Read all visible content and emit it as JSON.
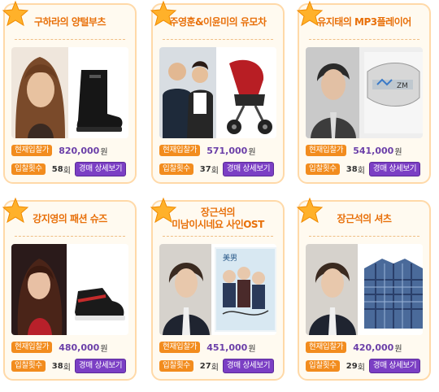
{
  "colors": {
    "accent": "#f28c1e",
    "title": "#e8700a",
    "price": "#6b3fa8",
    "button": "#7b3fc4"
  },
  "labels": {
    "current_bid": "현재입찰가",
    "bid_count": "입찰횟수",
    "detail_button": "경매 상세보기",
    "won_unit": "원",
    "count_unit": "회"
  },
  "items": [
    {
      "title": "구하라의 양털부츠",
      "price": "820,000",
      "bids": "58"
    },
    {
      "title": "주영훈&이윤미의 유모차",
      "price": "571,000",
      "bids": "37"
    },
    {
      "title": "유지태의 MP3플레이어",
      "price": "541,000",
      "bids": "38"
    },
    {
      "title": "강지영의 패션 슈즈",
      "price": "480,000",
      "bids": "38"
    },
    {
      "title_line1": "장근석의",
      "title_line2": "미남이시네요 사인OST",
      "price": "451,000",
      "bids": "27"
    },
    {
      "title": "장근석의 셔츠",
      "price": "420,000",
      "bids": "29"
    }
  ]
}
